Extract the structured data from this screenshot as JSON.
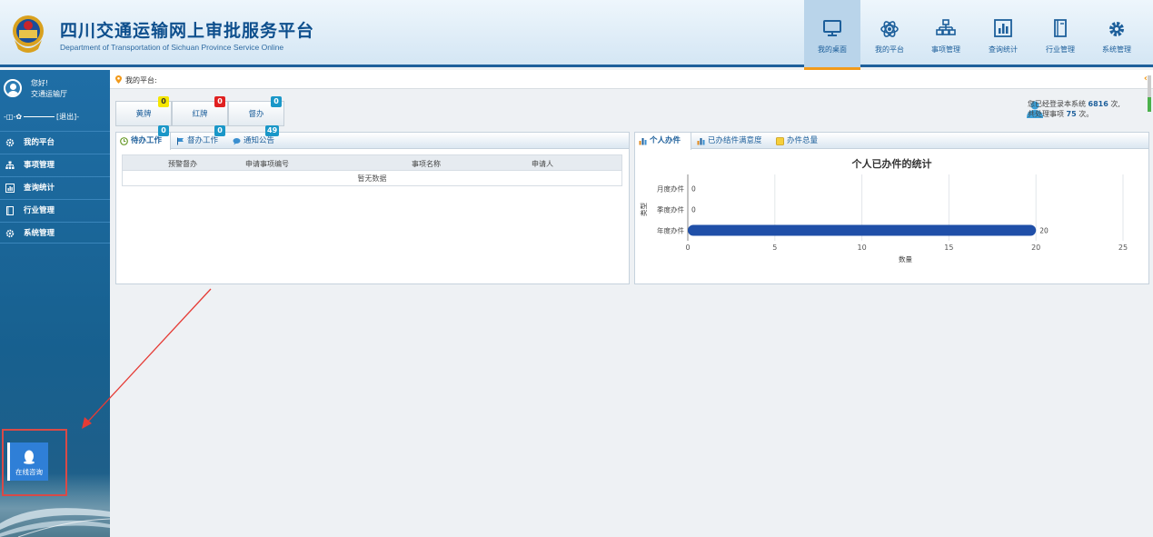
{
  "header": {
    "title": "四川交通运输网上审批服务平台",
    "subtitle": "Department of Transportation of Sichuan Province Service Online",
    "nav": [
      {
        "label": "我的桌面",
        "icon": "monitor-icon",
        "active": true
      },
      {
        "label": "我的平台",
        "icon": "atom-icon",
        "active": false
      },
      {
        "label": "事项管理",
        "icon": "sitemap-icon",
        "active": false
      },
      {
        "label": "查询统计",
        "icon": "bar-chart-icon",
        "active": false
      },
      {
        "label": "行业管理",
        "icon": "book-icon",
        "active": false
      },
      {
        "label": "系统管理",
        "icon": "gear-icon",
        "active": false
      }
    ]
  },
  "sidebar": {
    "greeting": "您好!",
    "org": "交通运输厅",
    "logout": "[退出]",
    "items": [
      {
        "label": "我的平台",
        "icon": "gear-icon"
      },
      {
        "label": "事项管理",
        "icon": "sitemap-icon"
      },
      {
        "label": "查询统计",
        "icon": "bar-chart-icon"
      },
      {
        "label": "行业管理",
        "icon": "book-icon"
      },
      {
        "label": "系统管理",
        "icon": "gear-icon"
      }
    ],
    "online_consult": "在线咨询"
  },
  "breadcrumb": {
    "label": "我的平台:"
  },
  "counters": [
    {
      "label": "黄牌",
      "count": "0",
      "color": "#f5e600",
      "text_color": "#333"
    },
    {
      "label": "红牌",
      "count": "0",
      "color": "#e02020",
      "text_color": "#fff"
    },
    {
      "label": "督办",
      "count": "0",
      "color": "#1a97c8",
      "text_color": "#fff"
    }
  ],
  "login_info": {
    "line1_prefix": "您已经登录本系统",
    "login_count": "6816",
    "line1_suffix": "次,",
    "line2_prefix": "共处理事项",
    "handled_count": "75",
    "line2_suffix": "次。"
  },
  "work_panel": {
    "tabs": [
      {
        "label": "待办工作",
        "badge": "0",
        "active": true
      },
      {
        "label": "督办工作",
        "badge": "0",
        "active": false
      },
      {
        "label": "通知公告",
        "badge": "49",
        "active": false
      }
    ],
    "columns": [
      "预警督办",
      "申请事项编号",
      "事项名称",
      "申请人"
    ],
    "empty_text": "暂无数据"
  },
  "stats_panel": {
    "tabs": [
      {
        "label": "个人办件",
        "active": true
      },
      {
        "label": "已办结件满意度",
        "active": false
      },
      {
        "label": "办件总量",
        "active": false
      }
    ]
  },
  "chart_data": {
    "type": "bar",
    "orientation": "horizontal",
    "title": "个人已办件的统计",
    "categories": [
      "月度办件",
      "季度办件",
      "年度办件"
    ],
    "values": [
      0,
      0,
      20
    ],
    "xlabel": "数量",
    "ylabel": "类型",
    "xlim": [
      0,
      25
    ],
    "xticks": [
      0,
      5,
      10,
      15,
      20,
      25
    ],
    "grid": true,
    "bar_color": "#1f4fa8"
  }
}
